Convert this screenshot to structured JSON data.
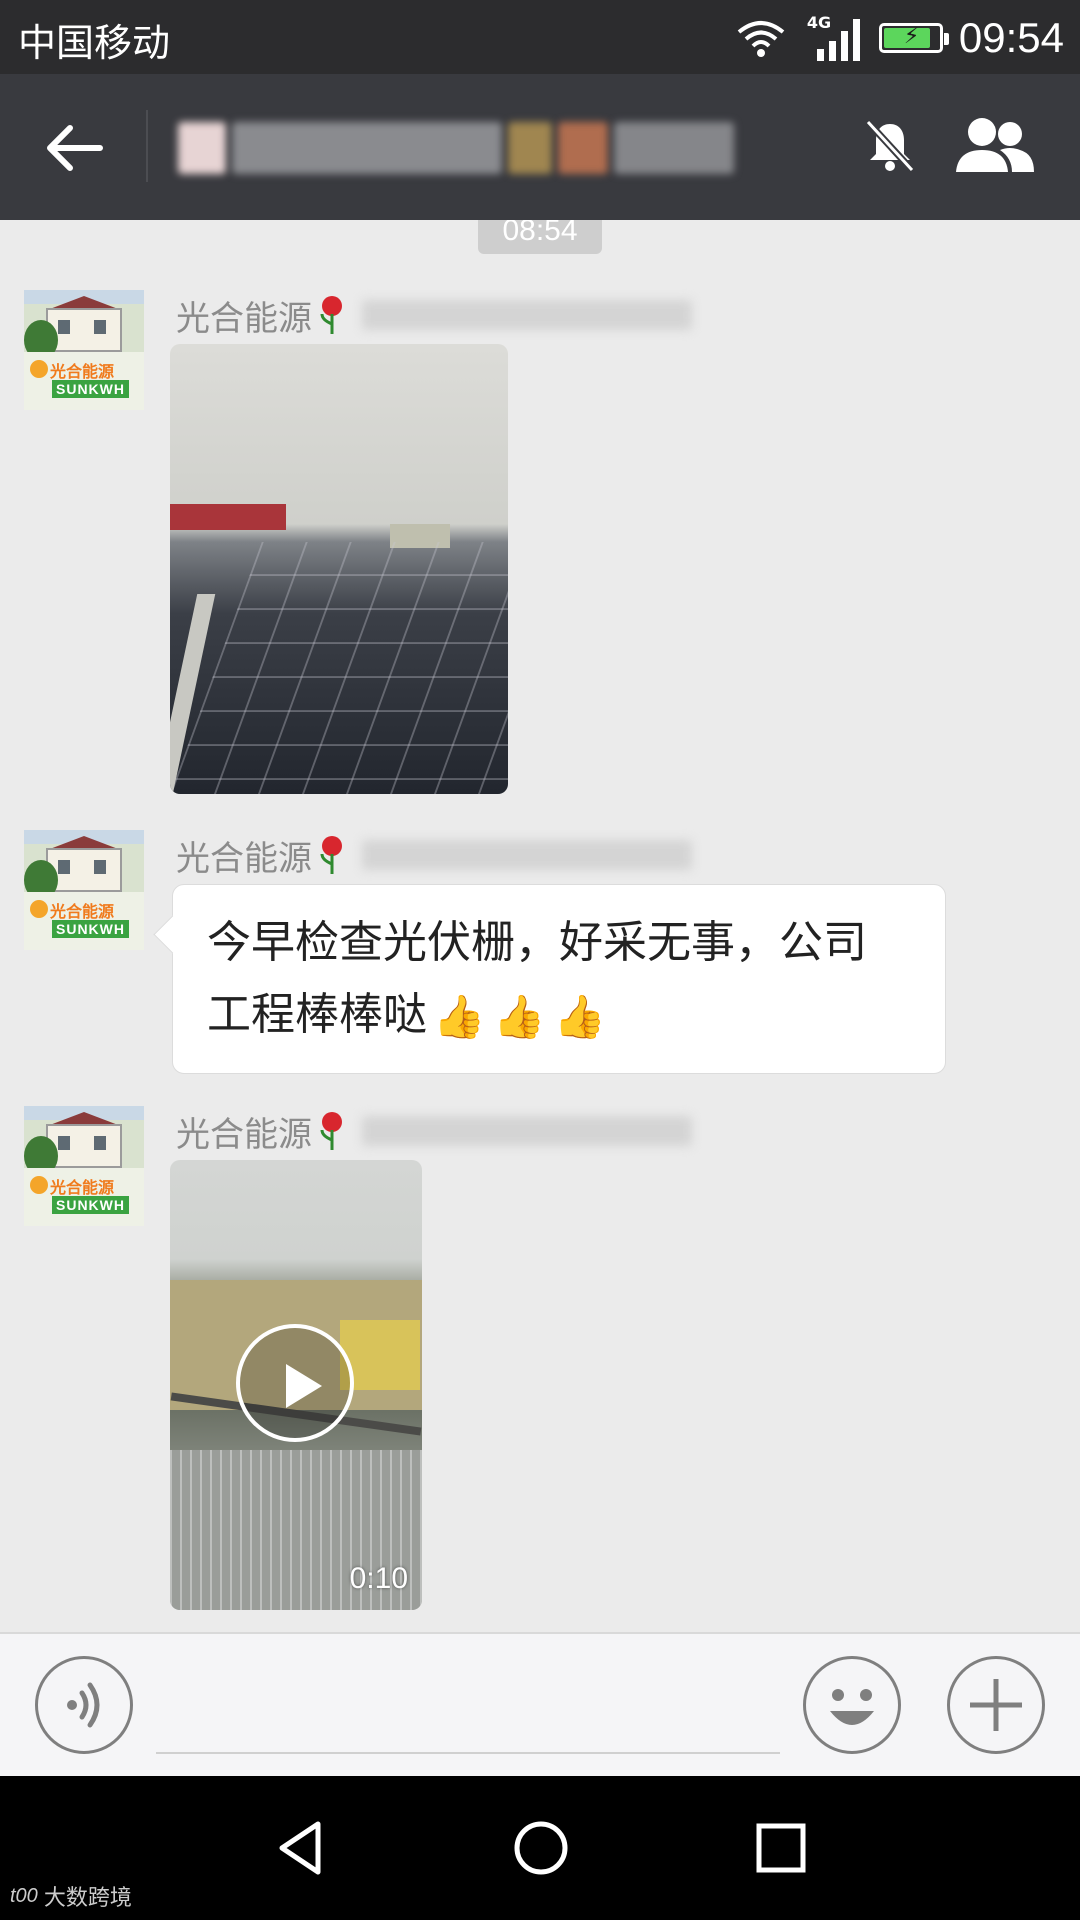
{
  "status_bar": {
    "carrier": "中国移动",
    "network": "4G",
    "time": "09:54",
    "battery_level": 0.8,
    "battery_color": "#5cd65c"
  },
  "header": {
    "back_icon": "arrow-left-icon",
    "mute_icon": "bell-off-icon",
    "members_icon": "group-icon"
  },
  "chat": {
    "timestamp": "08:54",
    "messages": [
      {
        "sender": "光合能源",
        "type": "image"
      },
      {
        "sender": "光合能源",
        "type": "text",
        "text_line1": "今早检查光伏栅，好采无事，公司",
        "text_line2": "工程棒棒哒"
      },
      {
        "sender": "光合能源",
        "type": "video",
        "duration": "0:10"
      }
    ],
    "avatar": {
      "logo_text": "光合能源",
      "logo_sub": "SUNKWH"
    }
  },
  "input_bar": {
    "voice_icon": "voice-icon",
    "emoji_icon": "emoji-icon",
    "plus_icon": "plus-icon",
    "placeholder": ""
  },
  "nav": {
    "back_icon": "nav-back-icon",
    "home_icon": "nav-home-icon",
    "recent_icon": "nav-recent-icon"
  },
  "watermark": {
    "logo": "t00",
    "text": "大数跨境"
  },
  "colors": {
    "header_bg": "#393a3f",
    "chat_bg": "#ebebeb",
    "accent_green": "#3aa341"
  }
}
